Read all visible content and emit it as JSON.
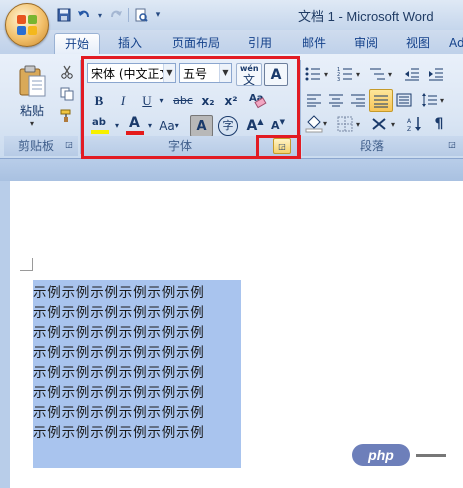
{
  "window": {
    "title": "文档 1 - Microsoft Word"
  },
  "quick_access": {
    "icons": [
      "save-icon",
      "undo-icon",
      "redo-icon",
      "print-preview-icon",
      "customize-icon"
    ]
  },
  "tabs": [
    {
      "label": "开始",
      "active": true
    },
    {
      "label": "插入"
    },
    {
      "label": "页面布局"
    },
    {
      "label": "引用"
    },
    {
      "label": "邮件"
    },
    {
      "label": "审阅"
    },
    {
      "label": "视图"
    }
  ],
  "clipboard": {
    "paste_label": "粘贴",
    "group_label": "剪贴板"
  },
  "font": {
    "font_name": "宋体 (中文正文)",
    "font_size": "五号",
    "phonetic_label": "wén",
    "char_border_label": "A",
    "bold": "B",
    "italic": "I",
    "underline": "U",
    "strikethrough": "abc",
    "subscript": "x₂",
    "superscript": "x²",
    "change_case": "Aa",
    "char_shading": "A",
    "enclose": "字",
    "grow": "A",
    "shrink": "A",
    "text_color": "A",
    "highlight_text": "ab",
    "group_label": "字体"
  },
  "paragraph": {
    "group_label": "段落"
  },
  "annotation": {
    "color": "#e21b23"
  },
  "document": {
    "lines": [
      "示例示例示例示例示例示例",
      "示例示例示例示例示例示例",
      "示例示例示例示例示例示例",
      "示例示例示例示例示例示例",
      "示例示例示例示例示例示例",
      "示例示例示例示例示例示例",
      "示例示例示例示例示例示例",
      "示例示例示例示例示例示例"
    ],
    "selection_color": "#a9c4ee"
  },
  "watermark": {
    "text": "php"
  }
}
